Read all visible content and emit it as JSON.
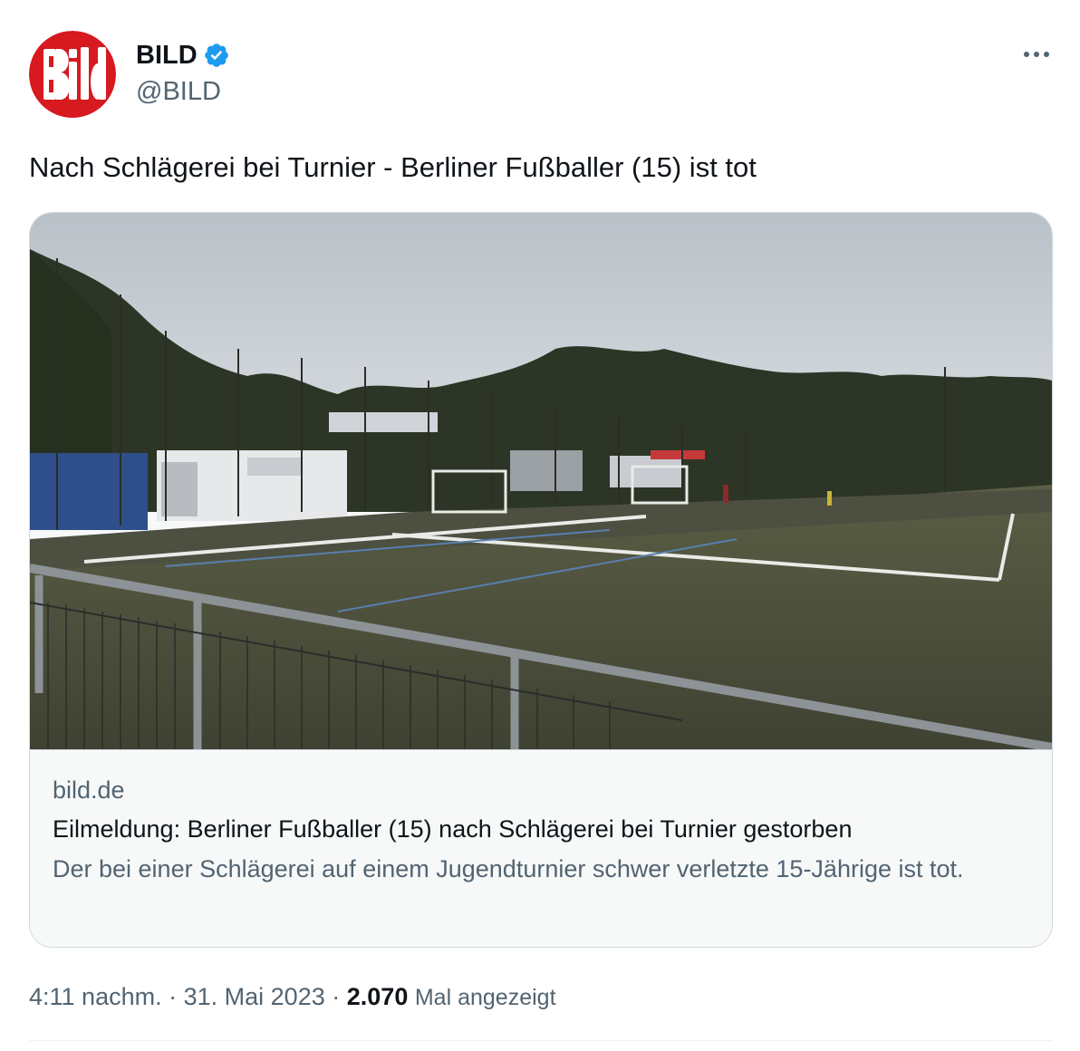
{
  "account": {
    "display_name": "BILD",
    "handle": "@BILD",
    "avatar_logo_text": "Bild",
    "verified": true,
    "verified_color": "#1d9bf0",
    "avatar_color": "#d71920"
  },
  "menu": {
    "icon": "more-dots-icon"
  },
  "tweet": {
    "text": "Nach Schlägerei bei Turnier - Berliner Fußballer (15) ist tot"
  },
  "card": {
    "domain": "bild.de",
    "title": "Eilmeldung: Berliner Fußballer (15) nach Schlägerei bei Turnier gestorben",
    "description": "Der bei einer Schlägerei auf einem Jugendturnier schwer verletzte 15-Jährige ist tot."
  },
  "meta": {
    "time": "4:11 nachm.",
    "separator": "·",
    "date": "31. Mai 2023",
    "views_count": "2.070",
    "views_label": "Mal angezeigt"
  }
}
